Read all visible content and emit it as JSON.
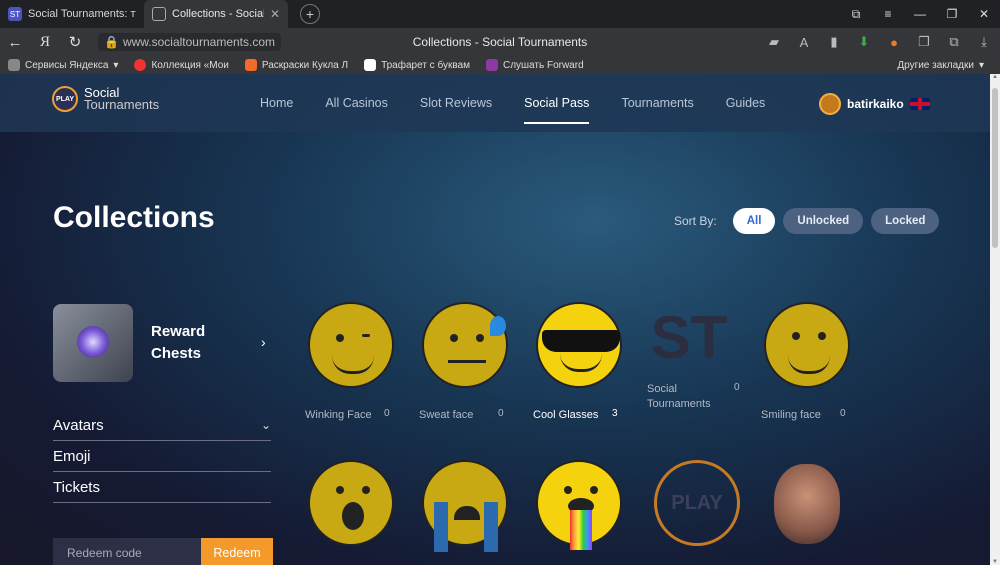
{
  "browser": {
    "tabs": [
      {
        "title": "Social Tournaments: турни",
        "active": false
      },
      {
        "title": "Collections - Social Tour",
        "active": true
      }
    ],
    "url": "www.socialtournaments.com",
    "page_title": "Collections - Social Tournaments",
    "bookmarks": [
      "Сервисы Яндекса",
      "Коллекция «Мои",
      "Раскраски Кукла Л",
      "Трафарет с буквам",
      "Слушать Forward"
    ],
    "bookmarks_other": "Другие закладки",
    "yandex_letter": "Я"
  },
  "site": {
    "logo_line1": "Social",
    "logo_line2": "Tournaments",
    "logo_badge": "PLAY",
    "nav": [
      "Home",
      "All Casinos",
      "Slot Reviews",
      "Social Pass",
      "Tournaments",
      "Guides"
    ],
    "active_nav": "Social Pass",
    "username": "batirkaiko"
  },
  "page": {
    "title": "Collections",
    "sort_label": "Sort By:",
    "sort_options": [
      "All",
      "Unlocked",
      "Locked"
    ],
    "active_sort": "All",
    "reward_chests": "Reward Chests",
    "categories": [
      "Avatars",
      "Emoji",
      "Tickets"
    ],
    "redeem_placeholder": "Redeem code",
    "redeem_button": "Redeem"
  },
  "items": [
    {
      "name": "Winking Face",
      "count": "0",
      "unlocked": false
    },
    {
      "name": "Sweat face",
      "count": "0",
      "unlocked": false
    },
    {
      "name": "Cool Glasses",
      "count": "3",
      "unlocked": true
    },
    {
      "name": "Social Tournaments",
      "count": "0",
      "unlocked": false
    },
    {
      "name": "Smiling face",
      "count": "0",
      "unlocked": false
    }
  ],
  "row2_logo_text": "PLAY"
}
